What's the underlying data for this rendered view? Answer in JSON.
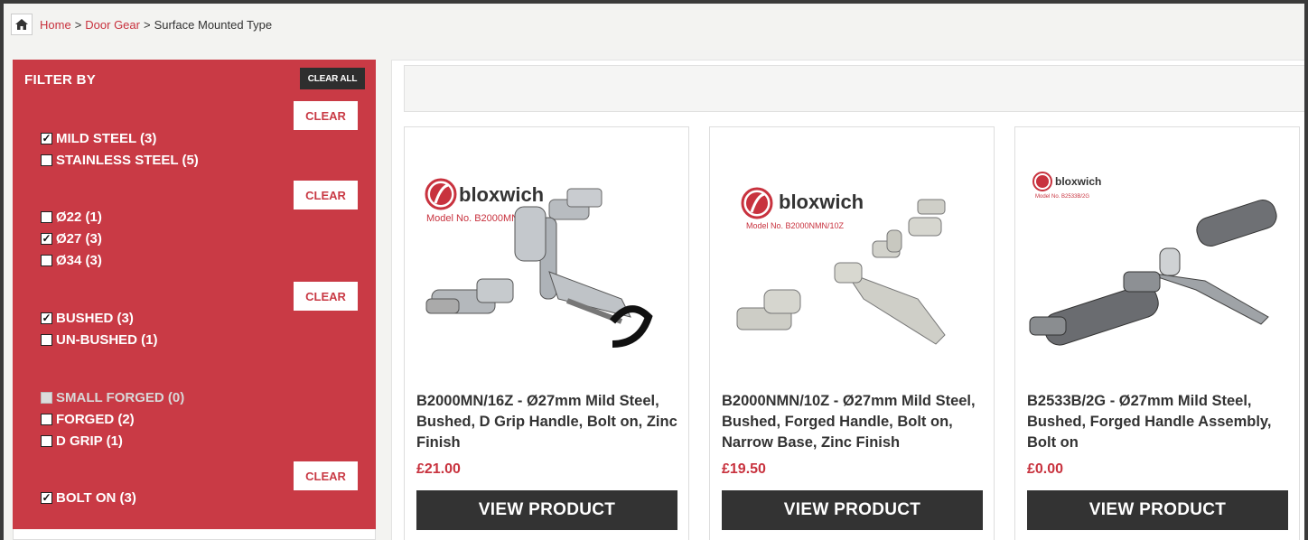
{
  "breadcrumb": {
    "home": "Home",
    "sep": ">",
    "category": "Door Gear",
    "current": "Surface Mounted Type"
  },
  "filter": {
    "title": "FILTER BY",
    "clear_all": "CLEAR ALL",
    "clear": "CLEAR",
    "groups": [
      {
        "options": [
          {
            "label": "MILD STEEL (3)",
            "checked": true
          },
          {
            "label": "STAINLESS STEEL (5)",
            "checked": false
          }
        ]
      },
      {
        "options": [
          {
            "label": "Ø22 (1)",
            "checked": false
          },
          {
            "label": "Ø27 (3)",
            "checked": true
          },
          {
            "label": "Ø34 (3)",
            "checked": false
          }
        ]
      },
      {
        "options": [
          {
            "label": "BUSHED (3)",
            "checked": true
          },
          {
            "label": "UN-BUSHED (1)",
            "checked": false
          }
        ]
      },
      {
        "options": [
          {
            "label": "SMALL FORGED (0)",
            "checked": false,
            "disabled": true
          },
          {
            "label": "FORGED (2)",
            "checked": false
          },
          {
            "label": "D GRIP (1)",
            "checked": false
          }
        ]
      },
      {
        "options": [
          {
            "label": "BOLT ON (3)",
            "checked": true
          }
        ]
      }
    ]
  },
  "products": [
    {
      "name": "B2000MN/16Z - Ø27mm Mild Steel, Bushed, D Grip Handle, Bolt on, Zinc Finish",
      "price": "£21.00",
      "button": "VIEW PRODUCT",
      "brand": "bloxwich",
      "model": "Model No. B2000MN/16Z"
    },
    {
      "name": "B2000NMN/10Z - Ø27mm Mild Steel, Bushed, Forged Handle, Bolt on, Narrow Base, Zinc Finish",
      "price": "£19.50",
      "button": "VIEW PRODUCT",
      "brand": "bloxwich",
      "model": "Model No. B2000NMN/10Z"
    },
    {
      "name": "B2533B/2G - Ø27mm Mild Steel, Bushed, Forged Handle Assembly, Bolt on",
      "price": "£0.00",
      "button": "VIEW PRODUCT",
      "brand": "bloxwich",
      "model": "Model No. B2533B/2G"
    }
  ],
  "colors": {
    "accent": "#c93a45",
    "price": "#c8323e",
    "button": "#333333"
  },
  "icons": {
    "home": "home-icon",
    "checkbox": "checkbox-icon",
    "logo": "bloxwich-logo"
  }
}
